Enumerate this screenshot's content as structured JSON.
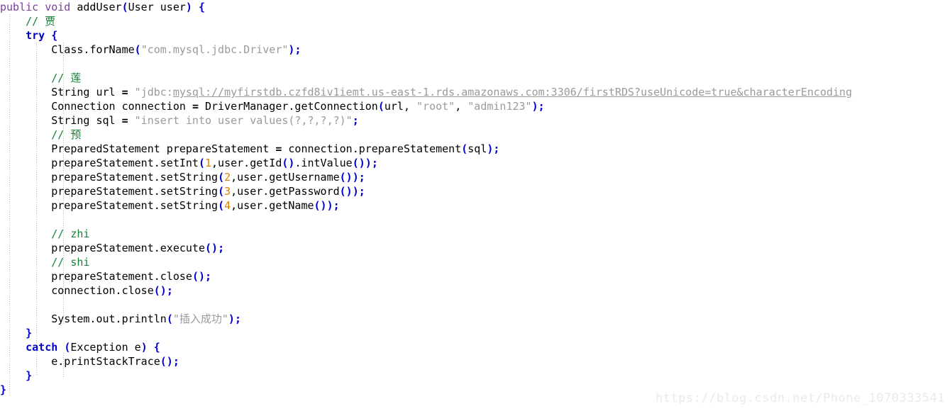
{
  "editor": {
    "language": "java",
    "background_color": "#ffffff",
    "watermark": "https://blog.csdn.net/Phone_1070333541",
    "colors": {
      "modifier_keyword": "#7a3e9d",
      "control_keyword": "#0000cd",
      "string": "#9a9a9a",
      "number": "#e08000",
      "comment": "#1a7f37",
      "punctuation": "#0000cd",
      "plain_text": "#000000",
      "indent_guide": "#b9b9b9",
      "watermark": "#eaeaea"
    }
  },
  "code": {
    "lines": [
      {
        "indent": "",
        "tokens": [
          {
            "t": "public",
            "c": "kw-mod"
          },
          {
            "t": " ",
            "c": "plain"
          },
          {
            "t": "void",
            "c": "kw-mod"
          },
          {
            "t": " addUser",
            "c": "plain"
          },
          {
            "t": "(",
            "c": "punct"
          },
          {
            "t": "User user",
            "c": "plain"
          },
          {
            "t": ")",
            "c": "punct"
          },
          {
            "t": " ",
            "c": "plain"
          },
          {
            "t": "{",
            "c": "brace"
          }
        ]
      },
      {
        "indent": "    ",
        "tokens": [
          {
            "t": "// 贾",
            "c": "comment"
          }
        ]
      },
      {
        "indent": "    ",
        "tokens": [
          {
            "t": "try",
            "c": "kw-ctrl"
          },
          {
            "t": " ",
            "c": "plain"
          },
          {
            "t": "{",
            "c": "brace"
          }
        ]
      },
      {
        "indent": "        ",
        "tokens": [
          {
            "t": "Class.forName",
            "c": "plain"
          },
          {
            "t": "(",
            "c": "punct"
          },
          {
            "t": "\"com.mysql.jdbc.Driver\"",
            "c": "str"
          },
          {
            "t": ")",
            "c": "punct"
          },
          {
            "t": ";",
            "c": "punct"
          }
        ]
      },
      {
        "indent": "",
        "tokens": []
      },
      {
        "indent": "        ",
        "tokens": [
          {
            "t": "// 莲",
            "c": "comment"
          }
        ]
      },
      {
        "indent": "        ",
        "tokens": [
          {
            "t": "String url ",
            "c": "plain"
          },
          {
            "t": "=",
            "c": "op"
          },
          {
            "t": " ",
            "c": "plain"
          },
          {
            "t": "\"jdbc:",
            "c": "str"
          },
          {
            "t": "mysql://myfirstdb.czfd8iv1iemt.us-east-1.rds.amazonaws.com:3306/firstRDS?useUnicode=true&characterEncoding",
            "c": "str-url"
          }
        ]
      },
      {
        "indent": "        ",
        "tokens": [
          {
            "t": "Connection connection ",
            "c": "plain"
          },
          {
            "t": "=",
            "c": "op"
          },
          {
            "t": " DriverManager.getConnection",
            "c": "plain"
          },
          {
            "t": "(",
            "c": "punct"
          },
          {
            "t": "url, ",
            "c": "plain"
          },
          {
            "t": "\"root\"",
            "c": "str"
          },
          {
            "t": ", ",
            "c": "plain"
          },
          {
            "t": "\"admin123\"",
            "c": "str"
          },
          {
            "t": ")",
            "c": "punct"
          },
          {
            "t": ";",
            "c": "punct"
          }
        ]
      },
      {
        "indent": "        ",
        "tokens": [
          {
            "t": "String sql ",
            "c": "plain"
          },
          {
            "t": "=",
            "c": "op"
          },
          {
            "t": " ",
            "c": "plain"
          },
          {
            "t": "\"insert into user values(?,?,?,?)\"",
            "c": "str"
          },
          {
            "t": ";",
            "c": "punct"
          }
        ]
      },
      {
        "indent": "        ",
        "tokens": [
          {
            "t": "// 预",
            "c": "comment"
          }
        ]
      },
      {
        "indent": "        ",
        "tokens": [
          {
            "t": "PreparedStatement prepareStatement ",
            "c": "plain"
          },
          {
            "t": "=",
            "c": "op"
          },
          {
            "t": " connection.prepareStatement",
            "c": "plain"
          },
          {
            "t": "(",
            "c": "punct"
          },
          {
            "t": "sql",
            "c": "plain"
          },
          {
            "t": ")",
            "c": "punct"
          },
          {
            "t": ";",
            "c": "punct"
          }
        ]
      },
      {
        "indent": "        ",
        "tokens": [
          {
            "t": "prepareStatement.setInt",
            "c": "plain"
          },
          {
            "t": "(",
            "c": "punct"
          },
          {
            "t": "1",
            "c": "num"
          },
          {
            "t": ",user.getId",
            "c": "plain"
          },
          {
            "t": "()",
            "c": "punct"
          },
          {
            "t": ".intValue",
            "c": "plain"
          },
          {
            "t": "())",
            "c": "punct"
          },
          {
            "t": ";",
            "c": "punct"
          }
        ]
      },
      {
        "indent": "        ",
        "tokens": [
          {
            "t": "prepareStatement.setString",
            "c": "plain"
          },
          {
            "t": "(",
            "c": "punct"
          },
          {
            "t": "2",
            "c": "num"
          },
          {
            "t": ",user.getUsername",
            "c": "plain"
          },
          {
            "t": "())",
            "c": "punct"
          },
          {
            "t": ";",
            "c": "punct"
          }
        ]
      },
      {
        "indent": "        ",
        "tokens": [
          {
            "t": "prepareStatement.setString",
            "c": "plain"
          },
          {
            "t": "(",
            "c": "punct"
          },
          {
            "t": "3",
            "c": "num"
          },
          {
            "t": ",user.getPassword",
            "c": "plain"
          },
          {
            "t": "())",
            "c": "punct"
          },
          {
            "t": ";",
            "c": "punct"
          }
        ]
      },
      {
        "indent": "        ",
        "tokens": [
          {
            "t": "prepareStatement.setString",
            "c": "plain"
          },
          {
            "t": "(",
            "c": "punct"
          },
          {
            "t": "4",
            "c": "num"
          },
          {
            "t": ",user.getName",
            "c": "plain"
          },
          {
            "t": "())",
            "c": "punct"
          },
          {
            "t": ";",
            "c": "punct"
          }
        ]
      },
      {
        "indent": "",
        "tokens": []
      },
      {
        "indent": "        ",
        "tokens": [
          {
            "t": "// zhi",
            "c": "comment"
          }
        ]
      },
      {
        "indent": "        ",
        "tokens": [
          {
            "t": "prepareStatement.execute",
            "c": "plain"
          },
          {
            "t": "()",
            "c": "punct"
          },
          {
            "t": ";",
            "c": "punct"
          }
        ]
      },
      {
        "indent": "        ",
        "tokens": [
          {
            "t": "// shi",
            "c": "comment"
          }
        ]
      },
      {
        "indent": "        ",
        "tokens": [
          {
            "t": "prepareStatement.close",
            "c": "plain"
          },
          {
            "t": "()",
            "c": "punct"
          },
          {
            "t": ";",
            "c": "punct"
          }
        ]
      },
      {
        "indent": "        ",
        "tokens": [
          {
            "t": "connection.close",
            "c": "plain"
          },
          {
            "t": "()",
            "c": "punct"
          },
          {
            "t": ";",
            "c": "punct"
          }
        ]
      },
      {
        "indent": "",
        "tokens": []
      },
      {
        "indent": "        ",
        "tokens": [
          {
            "t": "System.out.println",
            "c": "plain"
          },
          {
            "t": "(",
            "c": "punct"
          },
          {
            "t": "\"插入成功\"",
            "c": "str"
          },
          {
            "t": ")",
            "c": "punct"
          },
          {
            "t": ";",
            "c": "punct"
          }
        ]
      },
      {
        "indent": "    ",
        "tokens": [
          {
            "t": "}",
            "c": "brace"
          }
        ]
      },
      {
        "indent": "    ",
        "tokens": [
          {
            "t": "catch",
            "c": "kw-ctrl"
          },
          {
            "t": " ",
            "c": "plain"
          },
          {
            "t": "(",
            "c": "punct"
          },
          {
            "t": "Exception e",
            "c": "plain"
          },
          {
            "t": ")",
            "c": "punct"
          },
          {
            "t": " ",
            "c": "plain"
          },
          {
            "t": "{",
            "c": "brace"
          }
        ]
      },
      {
        "indent": "        ",
        "tokens": [
          {
            "t": "e.printStackTrace",
            "c": "plain"
          },
          {
            "t": "()",
            "c": "punct"
          },
          {
            "t": ";",
            "c": "punct"
          }
        ]
      },
      {
        "indent": "    ",
        "tokens": [
          {
            "t": "}",
            "c": "brace"
          }
        ]
      },
      {
        "indent": "",
        "tokens": [
          {
            "t": "}",
            "c": "brace"
          }
        ]
      }
    ]
  }
}
